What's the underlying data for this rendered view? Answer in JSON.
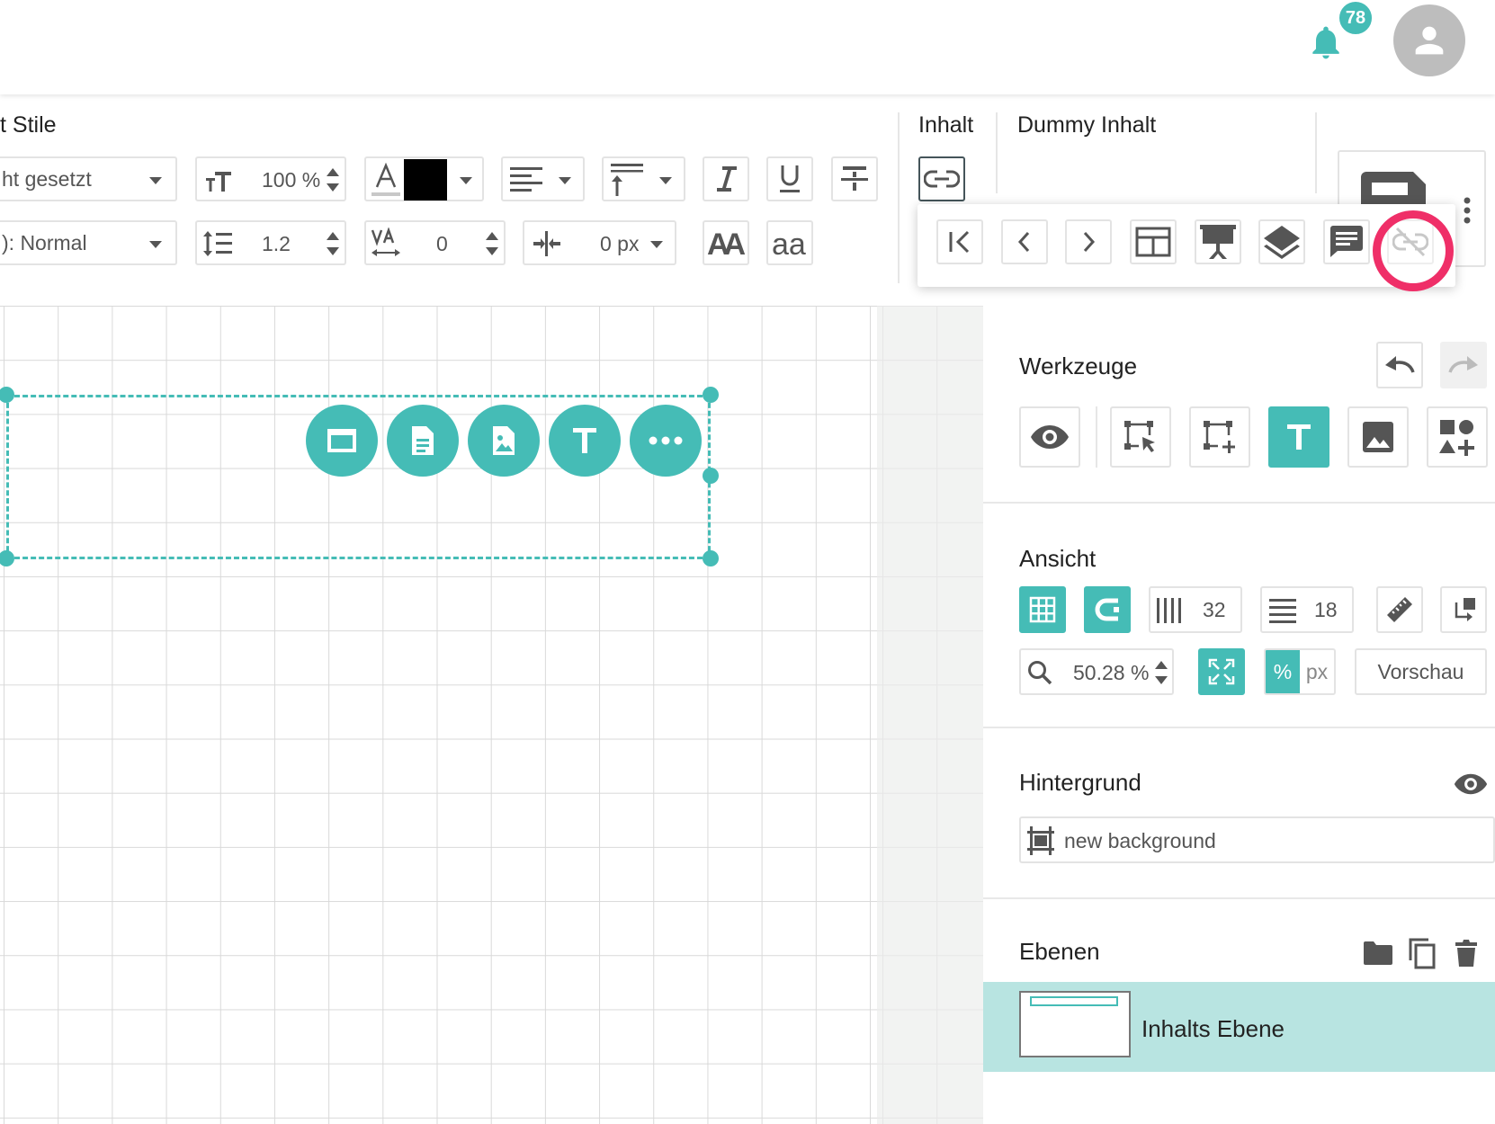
{
  "header": {
    "notification_count": "78"
  },
  "toolbar": {
    "styles_label": "t Stile",
    "font_select": "ht gesetzt",
    "style_select": "): Normal",
    "font_size": "100 %",
    "line_height": "1.2",
    "letter_spacing": "0",
    "indent": "0 px",
    "text_color": "#000000",
    "content_label": "Inhalt",
    "dummy_label": "Dummy Inhalt"
  },
  "panel": {
    "tools_title": "Werkzeuge",
    "view_title": "Ansicht",
    "columns_value": "32",
    "rows_value": "18",
    "zoom_value": "50.28 %",
    "unit_percent": "%",
    "unit_px": "px",
    "preview_label": "Vorschau",
    "background_title": "Hintergrund",
    "background_name": "new background",
    "layers_title": "Ebenen",
    "layer_name": "Inhalts Ebene"
  },
  "colors": {
    "accent": "#45bcb6",
    "highlight": "#ef2f68",
    "layer_selected": "#b8e4e1"
  }
}
